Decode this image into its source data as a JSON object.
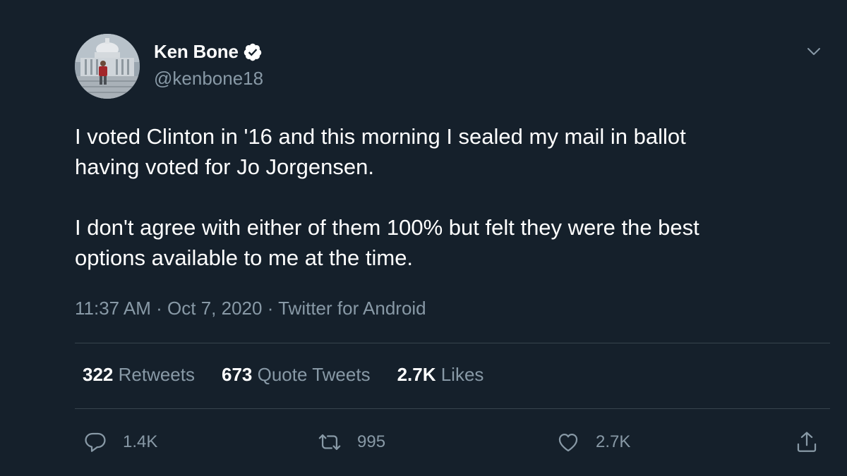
{
  "author": {
    "name": "Ken Bone",
    "handle": "@kenbone18",
    "verified": true
  },
  "tweet": {
    "text": "I voted Clinton in '16 and this morning I sealed my mail in ballot\nhaving voted for Jo Jorgensen.\n\nI don't agree with either of them 100% but felt they were the best\noptions available to me at the time.",
    "time": "11:37 AM",
    "separator": " · ",
    "date": "Oct 7, 2020",
    "source": "Twitter for Android"
  },
  "stats": {
    "retweets_count": "322",
    "retweets_label": " Retweets",
    "quotes_count": "673",
    "quotes_label": " Quote Tweets",
    "likes_count": "2.7K",
    "likes_label": " Likes"
  },
  "actions": {
    "reply_count": "1.4K",
    "retweet_count": "995",
    "like_count": "2.7K"
  },
  "icons": {
    "verified": "verified-badge-icon",
    "menu": "chevron-down-icon",
    "reply": "reply-bubble-icon",
    "retweet": "retweet-arrows-icon",
    "like": "heart-icon",
    "share": "share-upload-icon"
  },
  "colors": {
    "background": "#15202b",
    "secondary_text": "#8899a6",
    "divider": "#38444d"
  }
}
